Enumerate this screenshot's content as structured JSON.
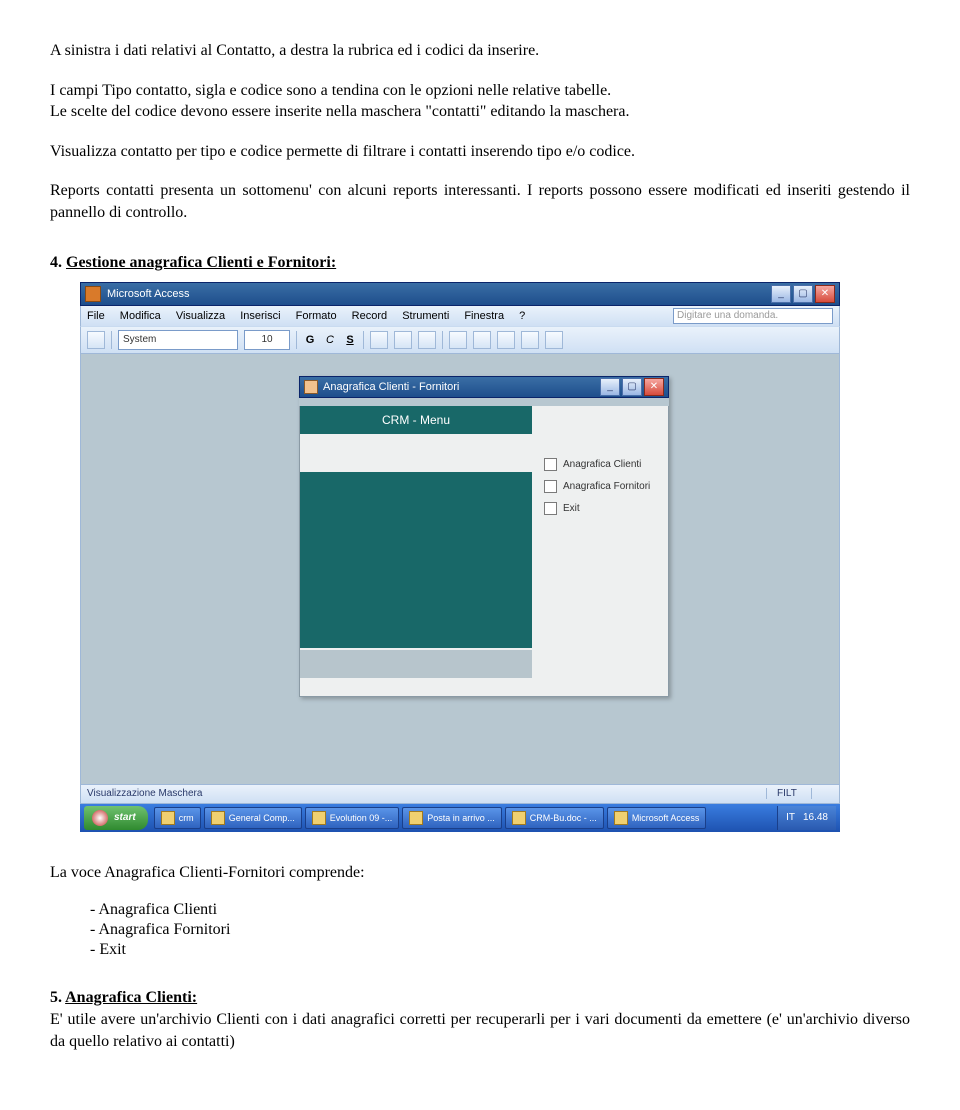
{
  "paragraphs": {
    "p1": "A sinistra i dati relativi al Contatto, a destra la rubrica ed i codici da inserire.",
    "p2": "I campi Tipo contatto, sigla e codice sono a tendina con le opzioni nelle relative tabelle.",
    "p3": "Le scelte del codice devono essere inserite nella maschera \"contatti\" editando la maschera.",
    "p4": "Visualizza contatto per tipo e codice permette di filtrare i contatti inserendo tipo e/o codice.",
    "p5": "Reports contatti presenta un sottomenu' con alcuni reports interessanti. I reports possono essere modificati ed inseriti gestendo il pannello di controllo."
  },
  "section4": {
    "num": "4. ",
    "title": "Gestione anagrafica Clienti e Fornitori:"
  },
  "screenshot": {
    "app_title": "Microsoft Access",
    "menubar": [
      "File",
      "Modifica",
      "Visualizza",
      "Inserisci",
      "Formato",
      "Record",
      "Strumenti",
      "Finestra",
      "?"
    ],
    "ask": "Digitare una domanda.",
    "font_name": "System",
    "font_size": "10",
    "fmt_bold": "G",
    "fmt_italic": "C",
    "fmt_underline": "S",
    "inner_title": "Anagrafica Clienti - Fornitori",
    "menu_header": "CRM - Menu",
    "options": [
      "Anagrafica Clienti",
      "Anagrafica Fornitori",
      "Exit"
    ],
    "status_left": "Visualizzazione Maschera",
    "status_right": "FILT",
    "start": "start",
    "taskbar": [
      "crm",
      "General Comp...",
      "Evolution 09 -...",
      "Posta in arrivo ...",
      "CRM-Bu.doc - ...",
      "Microsoft Access"
    ],
    "tray_lang": "IT",
    "tray_time": "16.48"
  },
  "after_shot": {
    "lead": "La voce Anagrafica Clienti-Fornitori comprende:",
    "items": [
      "Anagrafica Clienti",
      "Anagrafica Fornitori",
      "Exit"
    ]
  },
  "section5": {
    "num": "5. ",
    "title": "Anagrafica Clienti:",
    "body": "E' utile avere un'archivio Clienti con i dati anagrafici corretti per recuperarli per i vari documenti da emettere (e' un'archivio diverso da quello relativo ai contatti)"
  }
}
